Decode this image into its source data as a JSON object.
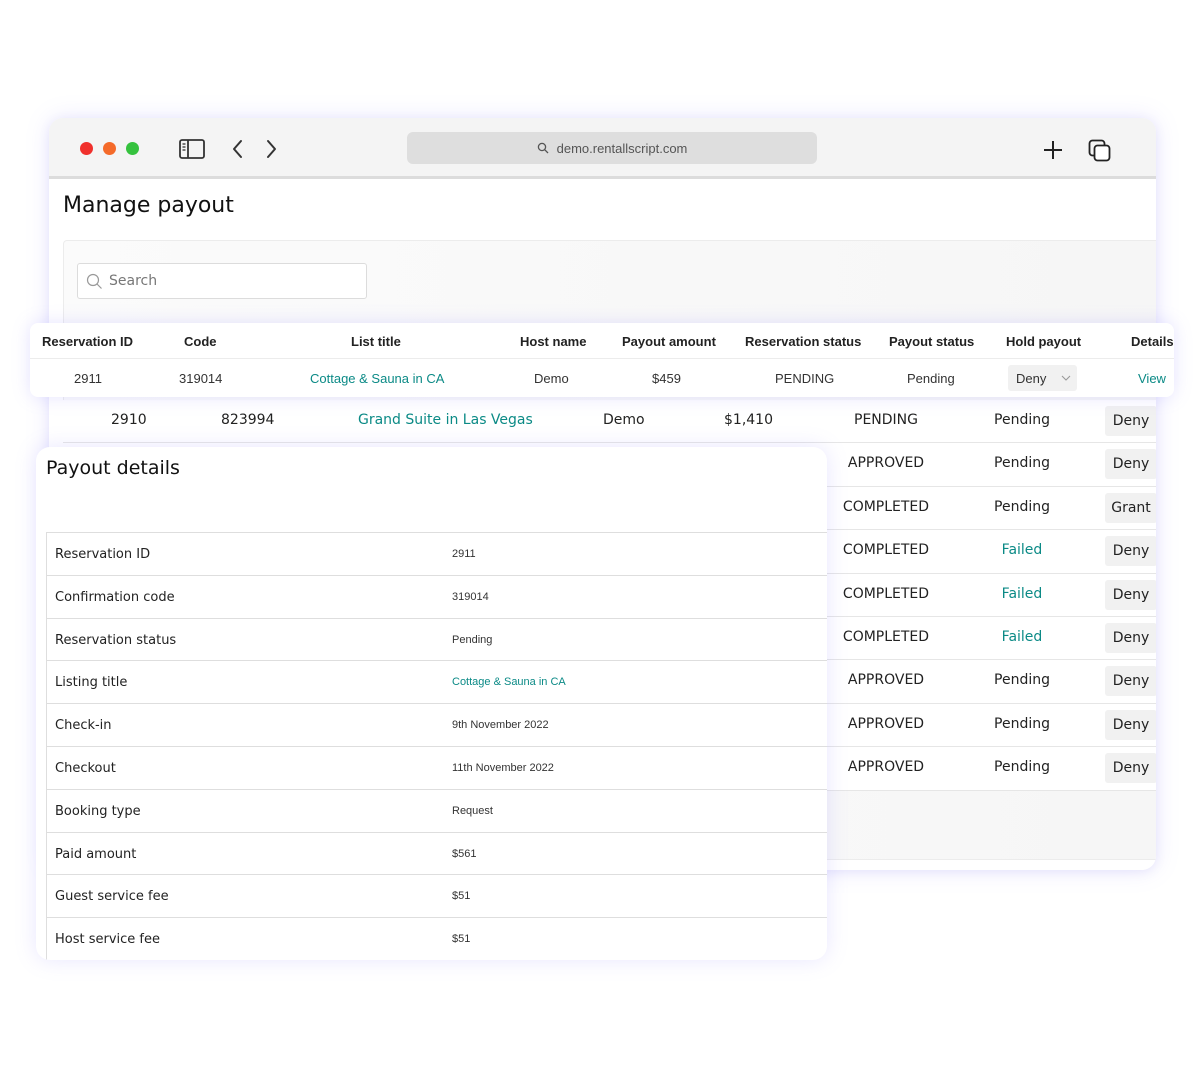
{
  "browser": {
    "url": "demo.rentallscript.com"
  },
  "page": {
    "title": "Manage payout",
    "search_placeholder": "Search"
  },
  "table": {
    "headers": [
      "Reservation ID",
      "Code",
      "List title",
      "Host name",
      "Payout amount",
      "Reservation status",
      "Payout status",
      "Hold payout",
      "Details"
    ],
    "highlighted_row": {
      "id": "2911",
      "code": "319014",
      "title": "Cottage & Sauna in CA",
      "host": "Demo",
      "amount": "$459",
      "reservation_status": "PENDING",
      "payout_status": "Pending",
      "hold": "Deny",
      "details": "View"
    },
    "rows": [
      {
        "id": "2910",
        "code": "823994",
        "title": "Grand Suite in Las Vegas",
        "host": "Demo",
        "amount": "$1,410",
        "reservation_status": "PENDING",
        "payout_status": "Pending",
        "hold": "Deny"
      },
      {
        "reservation_status": "APPROVED",
        "payout_status": "Pending",
        "hold": "Deny"
      },
      {
        "reservation_status": "COMPLETED",
        "payout_status": "Pending",
        "hold": "Grant"
      },
      {
        "reservation_status": "COMPLETED",
        "payout_status": "Failed",
        "hold": "Deny"
      },
      {
        "reservation_status": "COMPLETED",
        "payout_status": "Failed",
        "hold": "Deny"
      },
      {
        "reservation_status": "COMPLETED",
        "payout_status": "Failed",
        "hold": "Deny"
      },
      {
        "reservation_status": "APPROVED",
        "payout_status": "Pending",
        "hold": "Deny"
      },
      {
        "reservation_status": "APPROVED",
        "payout_status": "Pending",
        "hold": "Deny"
      },
      {
        "reservation_status": "APPROVED",
        "payout_status": "Pending",
        "hold": "Deny"
      }
    ]
  },
  "details": {
    "title": "Payout details",
    "rows": [
      {
        "label": "Reservation ID",
        "value": "2911"
      },
      {
        "label": "Confirmation code",
        "value": "319014"
      },
      {
        "label": "Reservation status",
        "value": "Pending"
      },
      {
        "label": "Listing title",
        "value": "Cottage & Sauna in CA"
      },
      {
        "label": "Check-in",
        "value": "9th November 2022"
      },
      {
        "label": "Checkout",
        "value": "11th November 2022"
      },
      {
        "label": "Booking type",
        "value": "Request"
      },
      {
        "label": "Paid amount",
        "value": "$561"
      },
      {
        "label": "Guest service fee",
        "value": "$51"
      },
      {
        "label": "Host service fee",
        "value": "$51"
      }
    ]
  },
  "colors": {
    "accent": "#0b8a86",
    "glow": "#8c82ff"
  }
}
